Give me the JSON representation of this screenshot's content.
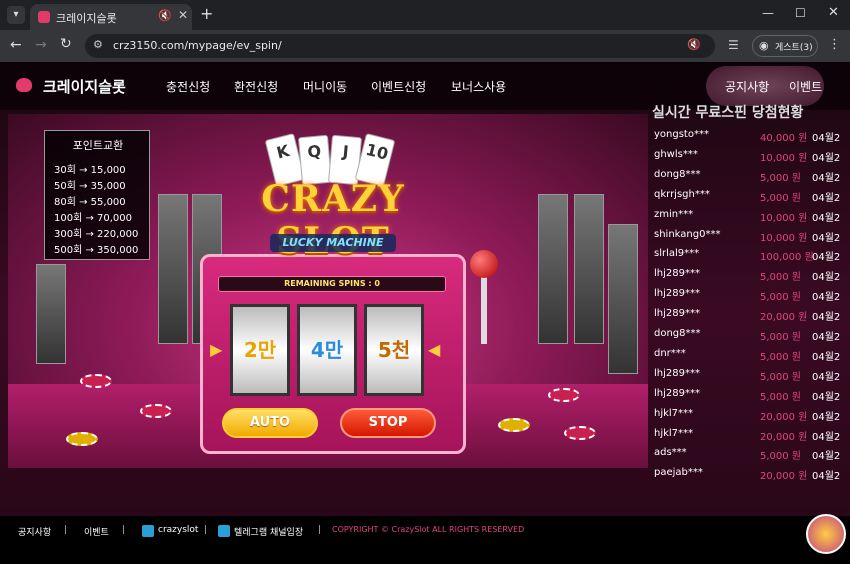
{
  "browser": {
    "tab_title": "크레이지슬롯",
    "url": "crz3150.com/mypage/ev_spin/",
    "profile_label": "게스트(3)"
  },
  "header": {
    "logo_text": "크레이지슬롯",
    "nav": [
      "충전신청",
      "환전신청",
      "머니이동",
      "이벤트신청",
      "보너스사용"
    ],
    "nav_right": [
      "공지사항",
      "이벤트"
    ]
  },
  "exchange": {
    "title": "포인트교환",
    "rows": [
      "30회 → 15,000",
      "50회 → 35,000",
      "80회 → 55,000",
      "100회 → 70,000",
      "300회 → 220,000",
      "500회 → 350,000"
    ]
  },
  "slot": {
    "cards": [
      "K",
      "Q",
      "J",
      "10"
    ],
    "title": "CRAZY SLOT",
    "subtitle": "LUCKY MACHINE",
    "remaining_label": "REMAINING SPINS : 0",
    "reels": [
      "2만",
      "4만",
      "5천"
    ],
    "auto_label": "AUTO",
    "stop_label": "STOP"
  },
  "winners": {
    "title": "실시간 무료스핀 당첨현황",
    "rows": [
      {
        "name": "yongsto***",
        "amount": "40,000 원",
        "date": "04월2"
      },
      {
        "name": "ghwls***",
        "amount": "10,000 원",
        "date": "04월2"
      },
      {
        "name": "dong8***",
        "amount": "5,000 원",
        "date": "04월2"
      },
      {
        "name": "qkrrjsgh***",
        "amount": "5,000 원",
        "date": "04월2"
      },
      {
        "name": "zmin***",
        "amount": "10,000 원",
        "date": "04월2"
      },
      {
        "name": "shinkang0***",
        "amount": "10,000 원",
        "date": "04월2"
      },
      {
        "name": "slrlal9***",
        "amount": "100,000 원",
        "date": "04월2"
      },
      {
        "name": "lhj289***",
        "amount": "5,000 원",
        "date": "04월2"
      },
      {
        "name": "lhj289***",
        "amount": "5,000 원",
        "date": "04월2"
      },
      {
        "name": "lhj289***",
        "amount": "20,000 원",
        "date": "04월2"
      },
      {
        "name": "dong8***",
        "amount": "5,000 원",
        "date": "04월2"
      },
      {
        "name": "dnr***",
        "amount": "5,000 원",
        "date": "04월2"
      },
      {
        "name": "lhj289***",
        "amount": "5,000 원",
        "date": "04월2"
      },
      {
        "name": "lhj289***",
        "amount": "5,000 원",
        "date": "04월2"
      },
      {
        "name": "hjkl7***",
        "amount": "20,000 원",
        "date": "04월2"
      },
      {
        "name": "hjkl7***",
        "amount": "20,000 원",
        "date": "04월2"
      },
      {
        "name": "ads***",
        "amount": "5,000 원",
        "date": "04월2"
      },
      {
        "name": "paejab***",
        "amount": "20,000 원",
        "date": "04월2"
      }
    ]
  },
  "footer": {
    "notice": "공지사항",
    "event": "이벤트",
    "telegram": "crazyslot",
    "telegram_channel": "텔레그램 채널입장",
    "separator": "|",
    "copyright": "COPYRIGHT © CrazySlot ALL RIGHTS RESERVED"
  }
}
